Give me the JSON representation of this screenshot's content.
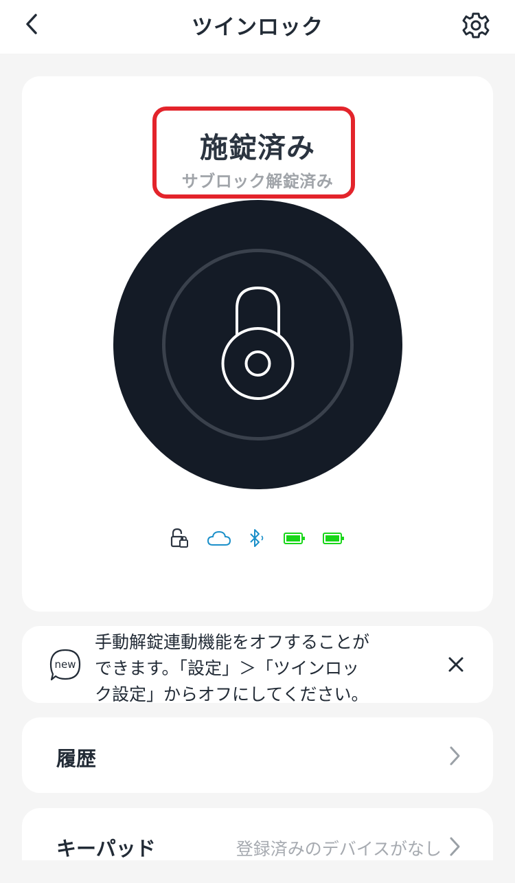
{
  "header": {
    "title": "ツインロック",
    "back_icon": "chevron-left-icon",
    "settings_icon": "gear-icon"
  },
  "lock_status": {
    "main": "施錠済み",
    "sub": "サブロック解錠済み",
    "highlight_color": "#e3242b",
    "dial_color": "#141b26",
    "lock_icon": "padlock-icon"
  },
  "status_icons": [
    {
      "name": "lock-status-icon",
      "color": "#2b3440"
    },
    {
      "name": "cloud-icon",
      "color": "#1a8fc9"
    },
    {
      "name": "bluetooth-icon",
      "color": "#1a8fc9"
    },
    {
      "name": "battery-icon",
      "level": 1.0,
      "color": "#19d619"
    },
    {
      "name": "battery-icon",
      "level": 1.0,
      "color": "#19d619"
    }
  ],
  "notice": {
    "badge_label": "new",
    "text": "手動解錠連動機能をオフすることができます。「設定」＞「ツインロック設定」からオフにしてください。",
    "close_icon": "close-icon"
  },
  "menu": {
    "history": {
      "label": "履歴"
    },
    "keypad": {
      "label": "キーパッド",
      "value": "登録済みのデバイスがなし"
    }
  }
}
